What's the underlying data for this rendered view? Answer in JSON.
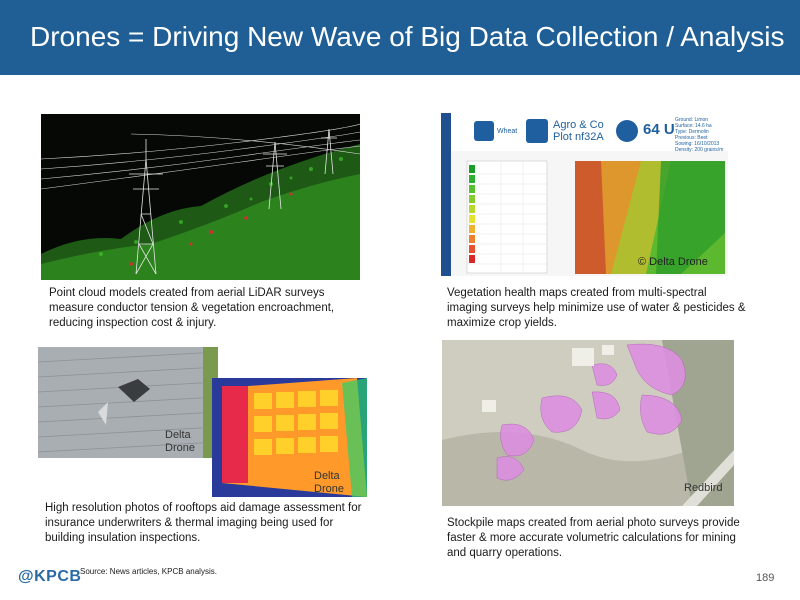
{
  "header": {
    "title": "Drones = Driving New Wave of Big Data Collection / Analysis"
  },
  "panels": {
    "lidar": {
      "caption": "Point cloud models created from aerial LiDAR surveys measure conductor tension & vegetation encroachment, reducing inspection cost & injury."
    },
    "vegetation": {
      "caption": "Vegetation health maps created from multi-spectral imaging surveys help minimize use of water & pesticides & maximize crop yields.",
      "crop_label": "Wheat",
      "company": "Agro & Co",
      "plot": "Plot nf32A",
      "units": "64 U",
      "info_lines": [
        "Ground: Limon",
        "Surface: 14.6 ha",
        "Type: Dermolin",
        "Previous: Beet",
        "Sowing: 16/10/2013",
        "Density: 200 grains/m"
      ],
      "watermark": "© Delta Drone"
    },
    "roof": {
      "caption": "High resolution photos of rooftops aid damage assessment for insurance underwriters & thermal imaging being used for building insulation inspections.",
      "watermark1": "Delta Drone",
      "watermark2": "Delta Drone"
    },
    "stockpile": {
      "caption": "Stockpile maps created from aerial photo surveys provide faster & more accurate volumetric calculations for mining and quarry operations.",
      "watermark": "Redbird"
    }
  },
  "footer": {
    "logo": "@KPCB",
    "source": "Source: News articles, KPCB analysis.",
    "page": "189"
  },
  "colors": {
    "header": "#1f5f95",
    "logo": "#2b6aa3"
  }
}
